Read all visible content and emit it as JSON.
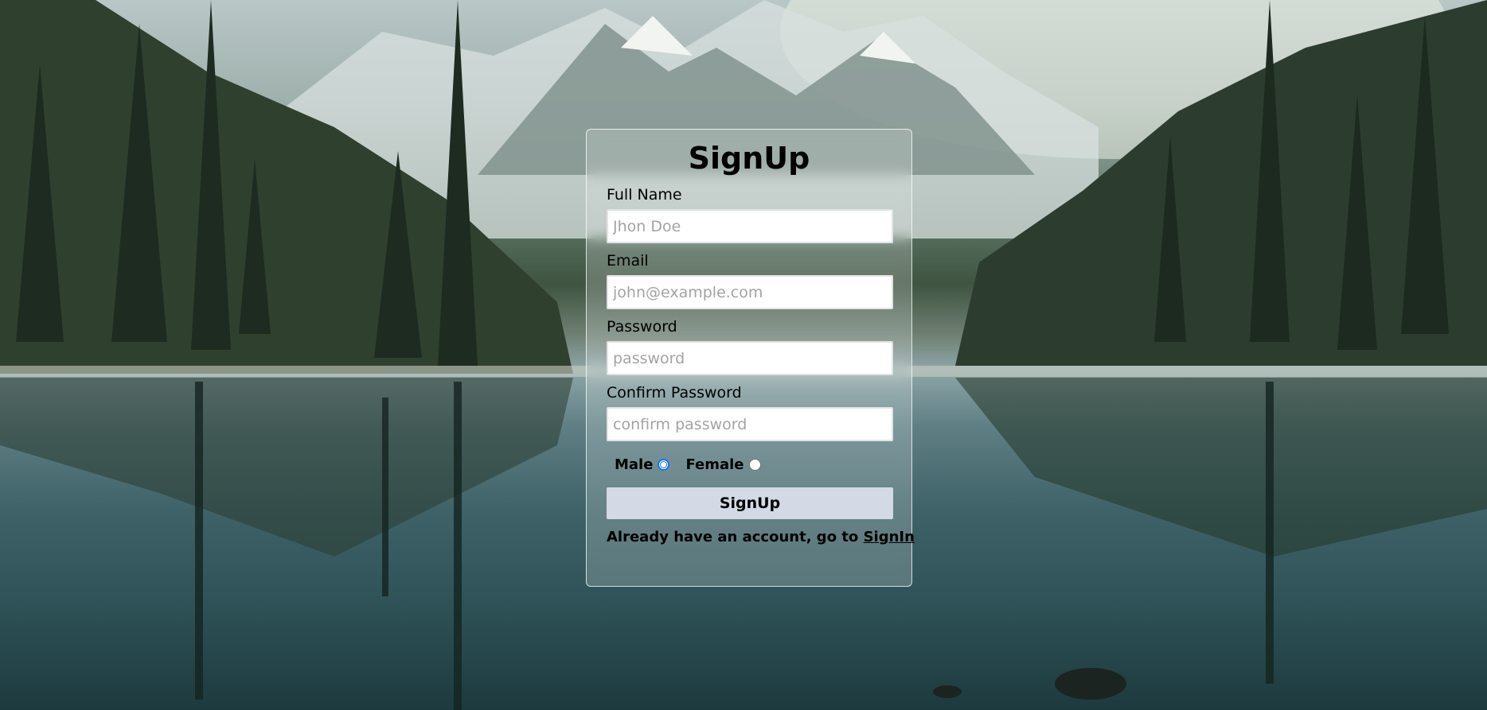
{
  "form": {
    "title": "SignUp",
    "fields": [
      {
        "label": "Full Name",
        "placeholder": "Jhon Doe",
        "value": ""
      },
      {
        "label": "Email",
        "placeholder": "john@example.com",
        "value": ""
      },
      {
        "label": "Password",
        "placeholder": "password",
        "value": ""
      },
      {
        "label": "Confirm Password",
        "placeholder": "confirm password",
        "value": ""
      }
    ],
    "gender": {
      "options": [
        "Male",
        "Female"
      ],
      "selected": "Male"
    },
    "submit_label": "SignUp",
    "footer_text": "Already have an account, go to ",
    "footer_link": "SignIn"
  },
  "colors": {
    "button_bg": "#d3dae5",
    "radio_accent": "#1a73e8",
    "card_border": "#ffffff"
  }
}
